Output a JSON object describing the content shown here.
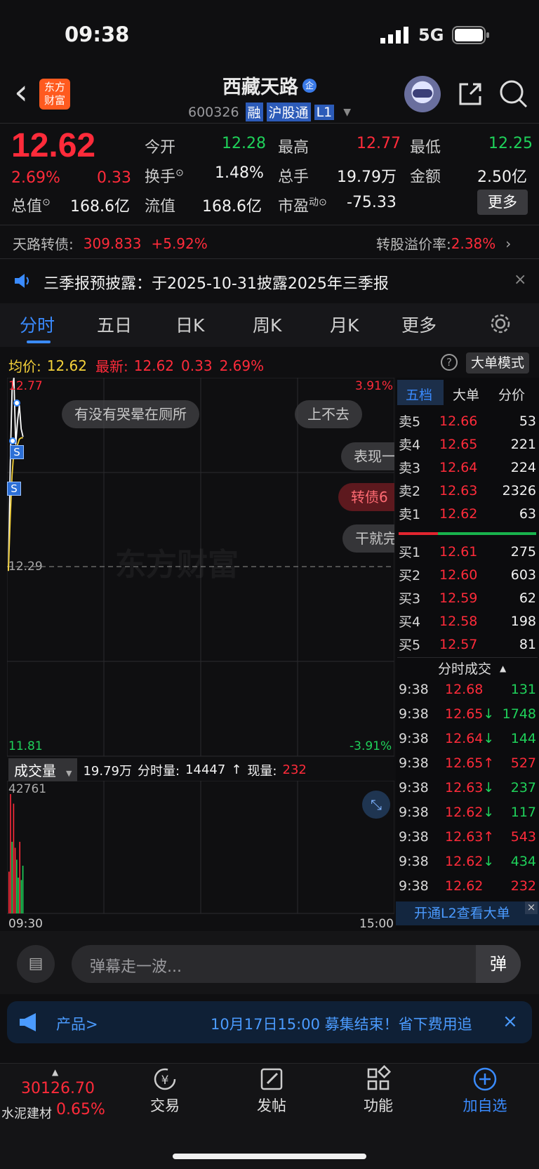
{
  "status_bar": {
    "time": "09:38",
    "network": "5G"
  },
  "header": {
    "back": "‹",
    "logo_line1": "东方",
    "logo_line2": "财富",
    "stock_name": "西藏天路",
    "name_badge": "企",
    "stock_code": "600326",
    "tags": [
      "融",
      "沪股通",
      "L1"
    ]
  },
  "quote": {
    "price": "12.62",
    "change_pct": "2.69%",
    "change": "0.33",
    "fields": [
      {
        "label": "今开",
        "value": "12.28"
      },
      {
        "label": "最高",
        "value": "12.77"
      },
      {
        "label": "最低",
        "value": "12.25"
      },
      {
        "label": "换手",
        "value": "1.48%"
      },
      {
        "label": "总手",
        "value": "19.79万"
      },
      {
        "label": "金额",
        "value": "2.50亿"
      },
      {
        "label": "总值",
        "value": "168.6亿"
      },
      {
        "label": "流值",
        "value": "168.6亿"
      },
      {
        "label": "市盈",
        "value": "-75.33",
        "sup": "动"
      }
    ],
    "more": "更多"
  },
  "bond": {
    "label": "天路转债:",
    "price": "309.833",
    "pct": "+5.92%",
    "premium_label": "转股溢价率:",
    "premium": "2.38%"
  },
  "notice": {
    "text": "三季报预披露：于2025-10-31披露2025年三季报"
  },
  "tabs": [
    "分时",
    "五日",
    "日K",
    "周K",
    "月K",
    "更多"
  ],
  "info_line": {
    "avg_label": "均价:",
    "avg": "12.62",
    "latest_label": "最新:",
    "latest": "12.62",
    "change": "0.33",
    "pct": "2.69%",
    "big_mode": "大单模式"
  },
  "chart": {
    "y_high": "12.77",
    "y_mid": "12.29",
    "y_low": "11.81",
    "pct_high": "3.91%",
    "pct_low": "-3.91%",
    "watermark": "东方财富",
    "badge": "S",
    "danmu": [
      "有没有哭晕在厕所",
      "上不去",
      "表现一",
      "转债6",
      "干就完"
    ]
  },
  "volume": {
    "label": "成交量",
    "total": "19.79万",
    "fenshi_label": "分时量:",
    "fenshi": "14447",
    "arrow": "↑",
    "now_label": "现量:",
    "now": "232",
    "max": "42761",
    "t_start": "09:30",
    "t_end": "15:00"
  },
  "chart_data": {
    "type": "line",
    "x": [
      "09:30",
      "09:31",
      "09:32",
      "09:33",
      "09:34",
      "09:35",
      "09:36",
      "09:37",
      "09:38"
    ],
    "price": [
      12.28,
      12.55,
      12.74,
      12.77,
      12.6,
      12.66,
      12.7,
      12.64,
      12.62
    ],
    "ylim": [
      11.81,
      12.77
    ],
    "volume_bars": [
      {
        "v": 0.35,
        "c": "red"
      },
      {
        "v": 1.0,
        "c": "red"
      },
      {
        "v": 0.6,
        "c": "green"
      },
      {
        "v": 0.92,
        "c": "red"
      },
      {
        "v": 0.55,
        "c": "red"
      },
      {
        "v": 0.45,
        "c": "green"
      },
      {
        "v": 0.3,
        "c": "green"
      },
      {
        "v": 0.6,
        "c": "red"
      },
      {
        "v": 0.28,
        "c": "green"
      },
      {
        "v": 0.4,
        "c": "green"
      }
    ]
  },
  "orderbook": {
    "tabs": [
      "五档",
      "大单",
      "分价"
    ],
    "asks": [
      {
        "label": "卖5",
        "price": "12.66",
        "vol": "53"
      },
      {
        "label": "卖4",
        "price": "12.65",
        "vol": "221"
      },
      {
        "label": "卖3",
        "price": "12.64",
        "vol": "224"
      },
      {
        "label": "卖2",
        "price": "12.63",
        "vol": "2326"
      },
      {
        "label": "卖1",
        "price": "12.62",
        "vol": "63"
      }
    ],
    "bids": [
      {
        "label": "买1",
        "price": "12.61",
        "vol": "275"
      },
      {
        "label": "买2",
        "price": "12.60",
        "vol": "603"
      },
      {
        "label": "买3",
        "price": "12.59",
        "vol": "62"
      },
      {
        "label": "买4",
        "price": "12.58",
        "vol": "198"
      },
      {
        "label": "买5",
        "price": "12.57",
        "vol": "81"
      }
    ]
  },
  "trades": {
    "title": "分时成交",
    "rows": [
      {
        "t": "9:38",
        "p": "12.68",
        "a": "",
        "v": "131",
        "vc": "#1fd15a"
      },
      {
        "t": "9:38",
        "p": "12.65",
        "a": "↓",
        "v": "1748",
        "vc": "#1fd15a"
      },
      {
        "t": "9:38",
        "p": "12.64",
        "a": "↓",
        "v": "144",
        "vc": "#1fd15a"
      },
      {
        "t": "9:38",
        "p": "12.65",
        "a": "↑",
        "v": "527",
        "vc": "#ff2b3a"
      },
      {
        "t": "9:38",
        "p": "12.63",
        "a": "↓",
        "v": "237",
        "vc": "#1fd15a"
      },
      {
        "t": "9:38",
        "p": "12.62",
        "a": "↓",
        "v": "117",
        "vc": "#1fd15a"
      },
      {
        "t": "9:38",
        "p": "12.63",
        "a": "↑",
        "v": "543",
        "vc": "#ff2b3a"
      },
      {
        "t": "9:38",
        "p": "12.62",
        "a": "↓",
        "v": "434",
        "vc": "#1fd15a"
      },
      {
        "t": "9:38",
        "p": "12.62",
        "a": "",
        "v": "232",
        "vc": "#ff2b3a"
      }
    ],
    "l2": "开通L2查看大单"
  },
  "comment": {
    "placeholder": "弹幕走一波...",
    "danmu_btn": "弹"
  },
  "promo": {
    "left": "产品>",
    "text": "10月17日15:00 募集结束！省下费用追"
  },
  "bottom": {
    "index_value": "30126.70",
    "index_name": "水泥建材",
    "index_pct": "0.65%",
    "nav": [
      "交易",
      "发帖",
      "功能",
      "加自选"
    ]
  },
  "colors": {
    "up": "#ff2b3a",
    "down": "#1fd15a",
    "accent": "#3a8bff",
    "avg_line": "#f5d23a"
  }
}
